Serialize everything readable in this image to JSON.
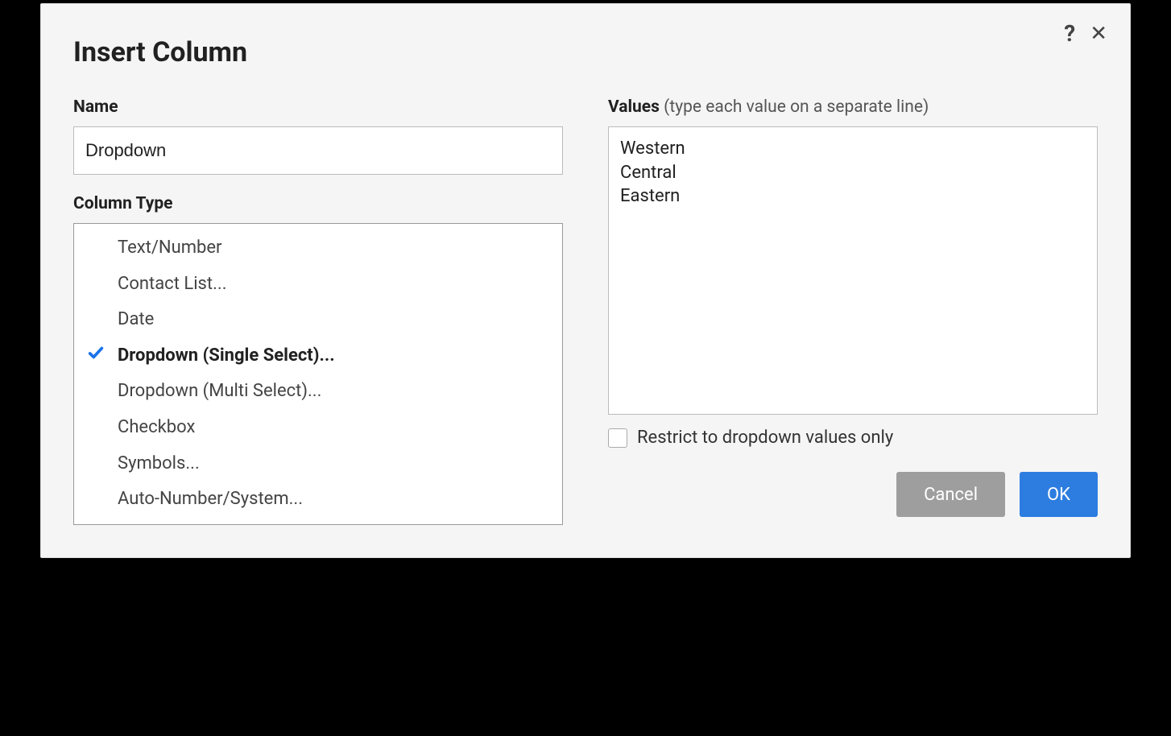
{
  "dialog": {
    "title": "Insert Column",
    "help_icon": "?",
    "close_icon": "✕"
  },
  "name_field": {
    "label": "Name",
    "value": "Dropdown"
  },
  "column_type": {
    "label": "Column Type",
    "items": [
      {
        "label": "Text/Number",
        "selected": false
      },
      {
        "label": "Contact List...",
        "selected": false
      },
      {
        "label": "Date",
        "selected": false
      },
      {
        "label": "Dropdown (Single Select)...",
        "selected": true
      },
      {
        "label": "Dropdown (Multi Select)...",
        "selected": false
      },
      {
        "label": "Checkbox",
        "selected": false
      },
      {
        "label": "Symbols...",
        "selected": false
      },
      {
        "label": "Auto-Number/System...",
        "selected": false
      }
    ]
  },
  "values": {
    "label": "Values",
    "hint": " (type each value on a separate line)",
    "text": "Western\nCentral\nEastern"
  },
  "restrict": {
    "label": "Restrict to dropdown values only",
    "checked": false
  },
  "buttons": {
    "cancel": "Cancel",
    "ok": "OK"
  }
}
